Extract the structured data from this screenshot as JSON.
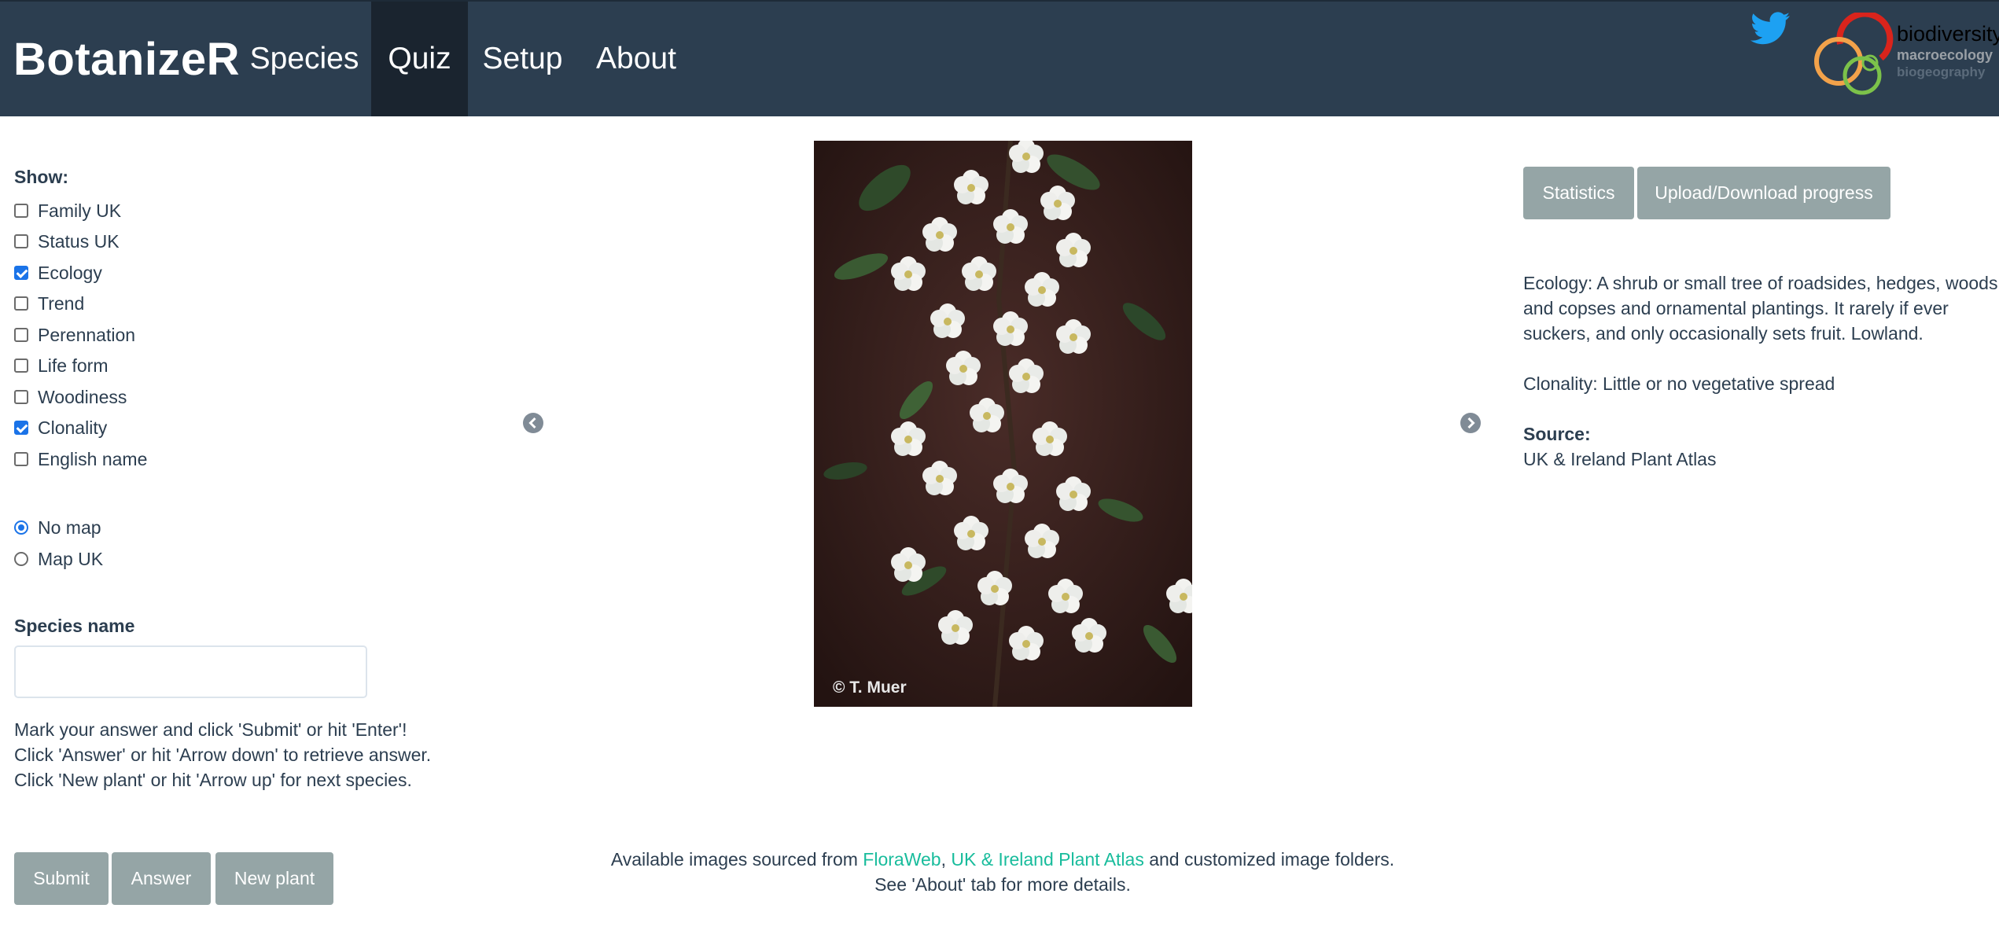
{
  "navbar": {
    "brand": "BotanizeR",
    "tabs": [
      {
        "label": "Species"
      },
      {
        "label": "Quiz"
      },
      {
        "label": "Setup"
      },
      {
        "label": "About"
      }
    ],
    "active_tab": "Quiz",
    "logo": {
      "line1": "biodiversity",
      "line2": "macroecology",
      "line3": "biogeography"
    }
  },
  "left": {
    "show_label": "Show:",
    "checkboxes": [
      {
        "label": "Family UK",
        "checked": false
      },
      {
        "label": "Status UK",
        "checked": false
      },
      {
        "label": "Ecology",
        "checked": true
      },
      {
        "label": "Trend",
        "checked": false
      },
      {
        "label": "Perennation",
        "checked": false
      },
      {
        "label": "Life form",
        "checked": false
      },
      {
        "label": "Woodiness",
        "checked": false
      },
      {
        "label": "Clonality",
        "checked": true
      },
      {
        "label": "English name",
        "checked": false
      }
    ],
    "radios": [
      {
        "label": "No map",
        "checked": true
      },
      {
        "label": "Map UK",
        "checked": false
      }
    ],
    "species_label": "Species name",
    "species_value": "",
    "instructions": [
      "Mark your answer and click 'Submit' or hit 'Enter'!",
      "Click 'Answer' or hit 'Arrow down' to retrieve answer.",
      "Click 'New plant' or hit 'Arrow up' for next species."
    ],
    "buttons": {
      "submit": "Submit",
      "answer": "Answer",
      "new_plant": "New plant"
    }
  },
  "center": {
    "photo_credit": "© T. Muer",
    "prev_icon": "chevron-left-circle-icon",
    "next_icon": "chevron-right-circle-icon"
  },
  "footer": {
    "prefix": "Available images sourced from ",
    "link1": "FloraWeb",
    "sep": ", ",
    "link2": "UK & Ireland Plant Atlas",
    "suffix": " and customized image folders.",
    "line2": "See 'About' tab for more details."
  },
  "right": {
    "buttons": {
      "statistics": "Statistics",
      "upload": "Upload/Download progress"
    },
    "ecology_lines": [
      "Ecology: A shrub or small tree of roadsides, hedges, woods",
      "and copses and ornamental plantings. It rarely if ever",
      "suckers, and only occasionally sets fruit. Lowland."
    ],
    "clonality": "Clonality: Little or no vegetative spread",
    "source_label": "Source:",
    "source_link": "UK & Ireland Plant Atlas"
  },
  "colors": {
    "navbar": "#2c3e50",
    "active_tab": "#1a242f",
    "button": "#95a5a6",
    "link": "#18bc9c",
    "checkbox_accent": "#1a73e8"
  }
}
